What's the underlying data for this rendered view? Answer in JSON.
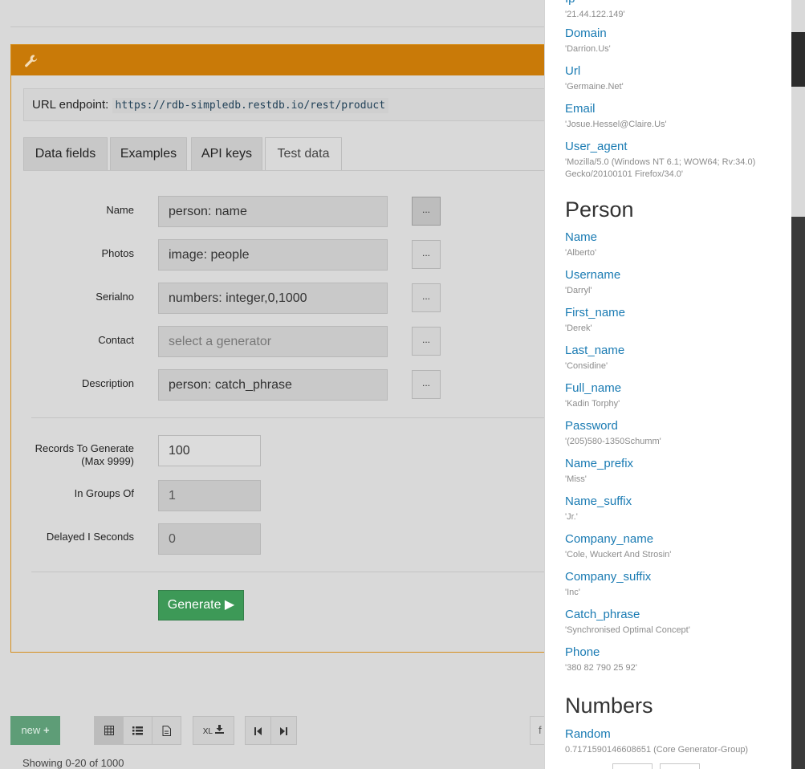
{
  "endpoint": {
    "label": "URL endpoint:",
    "url": "https://rdb-simpledb.restdb.io/rest/product"
  },
  "tabs": [
    {
      "label": "Data fields"
    },
    {
      "label": "Examples"
    },
    {
      "label": "API keys"
    },
    {
      "label": "Test data",
      "active": true
    }
  ],
  "fields": [
    {
      "label": "Name",
      "value": "person: name"
    },
    {
      "label": "Photos",
      "value": "image: people"
    },
    {
      "label": "Serialno",
      "value": "numbers: integer,0,1000"
    },
    {
      "label": "Contact",
      "placeholder": "select a generator"
    },
    {
      "label": "Description",
      "value": "person: catch_phrase"
    }
  ],
  "picker_label": "...",
  "settings": {
    "records_label": "Records To Generate",
    "records_sub": "(Max 9999)",
    "records_value": "100",
    "groups_label": "In Groups Of",
    "groups_value": "1",
    "delay_label": "Delayed I Seconds",
    "delay_value": "0"
  },
  "generate_label": "Generate ▶",
  "toolbar": {
    "new_label": "new",
    "new_icon": "plus-icon",
    "xl_label": "XL",
    "showing": "Showing 0-20 of 1000",
    "search_stub": "f"
  },
  "side": {
    "top_partial": "Ip",
    "top_partial_example": "'21.44.122.149'",
    "internet_items": [
      {
        "name": "Domain",
        "example": "'Darrion.Us'"
      },
      {
        "name": "Url",
        "example": "'Germaine.Net'"
      },
      {
        "name": "Email",
        "example": "'Josue.Hessel@Claire.Us'"
      },
      {
        "name": "User_agent",
        "example": "'Mozilla/5.0 (Windows NT 6.1; WOW64; Rv:34.0) Gecko/20100101 Firefox/34.0'"
      }
    ],
    "person_title": "Person",
    "person_items": [
      {
        "name": "Name",
        "example": "'Alberto'"
      },
      {
        "name": "Username",
        "example": "'Darryl'"
      },
      {
        "name": "First_name",
        "example": "'Derek'"
      },
      {
        "name": "Last_name",
        "example": "'Considine'"
      },
      {
        "name": "Full_name",
        "example": "'Kadin Torphy'"
      },
      {
        "name": "Password",
        "example": "'(205)580-1350Schumm'"
      },
      {
        "name": "Name_prefix",
        "example": "'Miss'"
      },
      {
        "name": "Name_suffix",
        "example": "'Jr.'"
      },
      {
        "name": "Company_name",
        "example": "'Cole, Wuckert And Strosin'"
      },
      {
        "name": "Company_suffix",
        "example": "'Inc'"
      },
      {
        "name": "Catch_phrase",
        "example": "'Synchronised Optimal Concept'"
      },
      {
        "name": "Phone",
        "example": "'380 82 790 25 92'"
      }
    ],
    "numbers_title": "Numbers",
    "numbers_items": [
      {
        "name": "Random",
        "example": "0.7171590146608651 (Core Generator-Group)"
      }
    ]
  },
  "colors": {
    "panel_header": "#c97a08",
    "link_blue": "#1a7bb3",
    "generate_green": "#3d9957"
  }
}
